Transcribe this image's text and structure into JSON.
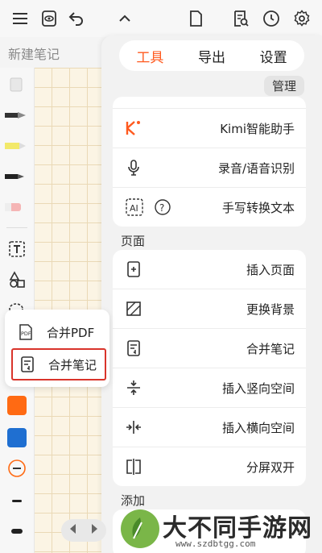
{
  "top_toolbar": {
    "icons": [
      "menu-icon",
      "eye-icon",
      "undo-icon",
      "chevron-up-icon",
      "page-icon",
      "search-page-icon",
      "clock-icon",
      "gear-icon"
    ]
  },
  "document": {
    "title": "新建笔记"
  },
  "panel": {
    "tabs": [
      {
        "label": "工具",
        "active": true
      },
      {
        "label": "导出",
        "active": false
      },
      {
        "label": "设置",
        "active": false
      }
    ],
    "manage_label": "管理",
    "top_items": [
      {
        "label": "Kimi智能助手",
        "icon": "kimi-icon"
      },
      {
        "label": "录音/语音识别",
        "icon": "microphone-icon"
      },
      {
        "label": "手写转换文本",
        "icon": "ai-icon"
      }
    ],
    "page_section": {
      "title": "页面",
      "items": [
        {
          "label": "插入页面",
          "icon": "insert-page-icon"
        },
        {
          "label": "更换背景",
          "icon": "background-icon"
        },
        {
          "label": "合并笔记",
          "icon": "merge-note-icon"
        },
        {
          "label": "插入竖向空间",
          "icon": "vertical-space-icon"
        },
        {
          "label": "插入横向空间",
          "icon": "horizontal-space-icon"
        },
        {
          "label": "分屏双开",
          "icon": "split-screen-icon"
        }
      ]
    },
    "add_section": {
      "title": "添加"
    }
  },
  "popup": {
    "items": [
      {
        "label": "合并PDF",
        "icon": "pdf-icon"
      },
      {
        "label": "合并笔记",
        "icon": "merge-note-icon"
      }
    ]
  },
  "colors": {
    "accent": "#ff5a1f",
    "tool_orange": "#ff6a13",
    "tool_blue": "#1f6fd1",
    "highlight_red": "#d9342b"
  },
  "watermark": {
    "text": "大不同手游网",
    "url": "www.szdbtgg.com"
  }
}
